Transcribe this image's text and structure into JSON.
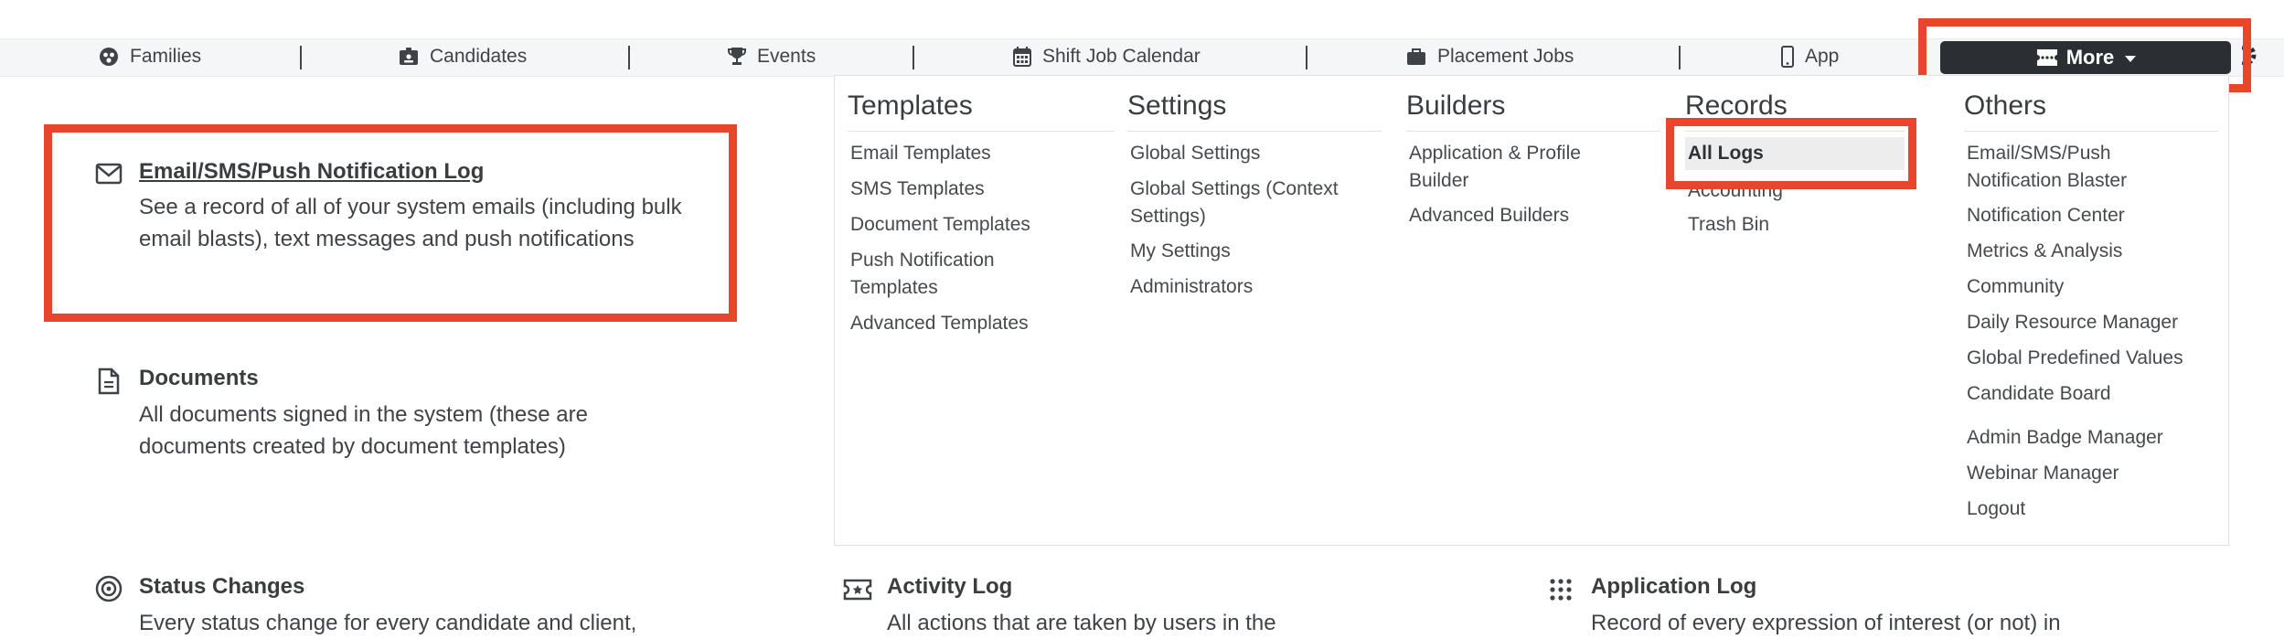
{
  "nav": {
    "items": [
      {
        "label": "Families",
        "icon": "families-icon"
      },
      {
        "label": "Candidates",
        "icon": "badge-icon"
      },
      {
        "label": "Events",
        "icon": "trophy-icon"
      },
      {
        "label": "Shift Job Calendar",
        "icon": "calendar-icon"
      },
      {
        "label": "Placement Jobs",
        "icon": "briefcase-icon"
      },
      {
        "label": "App",
        "icon": "mobile-icon"
      }
    ],
    "more_label": "More"
  },
  "dropdown": {
    "columns": [
      {
        "heading": "Templates",
        "links": [
          "Email Templates",
          "SMS Templates",
          "Document Templates",
          "Push Notification Templates",
          "Advanced Templates"
        ]
      },
      {
        "heading": "Settings",
        "links": [
          "Global Settings",
          "Global Settings (Context Settings)",
          "My Settings",
          "Administrators"
        ]
      },
      {
        "heading": "Builders",
        "links": [
          "Application & Profile Builder",
          "Advanced Builders"
        ]
      },
      {
        "heading": "Records",
        "links": [
          "All Logs",
          "Accounting",
          "Trash Bin"
        ]
      },
      {
        "heading": "Others",
        "links": [
          "Email/SMS/Push Notification Blaster",
          "Notification Center",
          "Metrics & Analysis",
          "Community",
          "Daily Resource Manager",
          "Global Predefined Values",
          "Candidate Board",
          "Admin Badge Manager",
          "Webinar Manager",
          "Logout"
        ]
      }
    ]
  },
  "logs": [
    {
      "title": "Email/SMS/Push Notification Log",
      "desc": "See a record of all of your system emails (including bulk email blasts), text messages and push notifications",
      "icon": "envelope-icon"
    },
    {
      "title": "Documents",
      "desc": "All documents signed in the system (these are documents created by document templates)",
      "icon": "document-icon"
    },
    {
      "title": "Status Changes",
      "desc": "Every status change for every candidate and client,",
      "icon": "status-icon"
    },
    {
      "title": "Activity Log",
      "desc": "All actions that are taken by users in the",
      "icon": "ticket-icon"
    },
    {
      "title": "Application Log",
      "desc": "Record of every expression of interest (or not) in",
      "icon": "grid-icon"
    }
  ],
  "colors": {
    "highlight": "#e8452c",
    "more_button": "#2b2f33",
    "nav_bg": "#f5f6f7"
  }
}
